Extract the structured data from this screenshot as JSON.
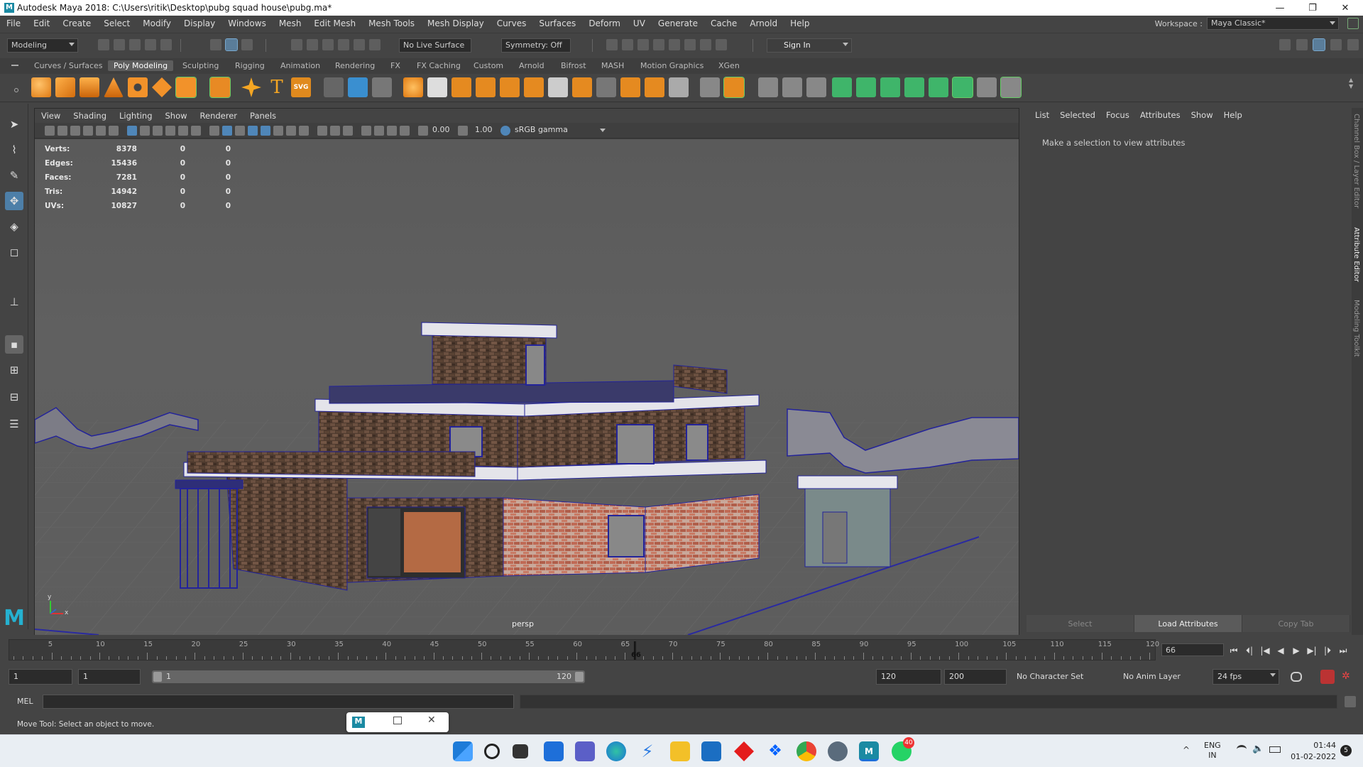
{
  "window": {
    "title": "Autodesk Maya 2018: C:\\Users\\ritik\\Desktop\\pubg squad house\\pubg.ma*",
    "app_icon": "maya-logo-icon",
    "controls": {
      "minimize": "—",
      "maximize": "❐",
      "close": "✕"
    }
  },
  "menubar": {
    "items": [
      "File",
      "Edit",
      "Create",
      "Select",
      "Modify",
      "Display",
      "Windows",
      "Mesh",
      "Edit Mesh",
      "Mesh Tools",
      "Mesh Display",
      "Curves",
      "Surfaces",
      "Deform",
      "UV",
      "Generate",
      "Cache",
      "Arnold",
      "Help"
    ],
    "workspace_label": "Workspace :",
    "workspace_value": "Maya Classic*"
  },
  "statusline": {
    "menuset": "Modeling",
    "live_surface": "No Live Surface",
    "symmetry": "Symmetry: Off",
    "sign_in": "Sign In"
  },
  "shelf": {
    "tabs": [
      "Curves / Surfaces",
      "Poly Modeling",
      "Sculpting",
      "Rigging",
      "Animation",
      "Rendering",
      "FX",
      "FX Caching",
      "Custom",
      "Arnold",
      "Bifrost",
      "MASH",
      "Motion Graphics",
      "XGen"
    ],
    "active_tab": "Poly Modeling",
    "text_tool_label": "T",
    "svg_tool_label": "SVG"
  },
  "viewport": {
    "menu": [
      "View",
      "Shading",
      "Lighting",
      "Show",
      "Renderer",
      "Panels"
    ],
    "exposure": "0.00",
    "gamma": "1.00",
    "color_space": "sRGB gamma",
    "camera_label": "persp",
    "hud": [
      {
        "label": "Verts:",
        "value": "8378",
        "sel": "0",
        "comp": "0"
      },
      {
        "label": "Edges:",
        "value": "15436",
        "sel": "0",
        "comp": "0"
      },
      {
        "label": "Faces:",
        "value": "7281",
        "sel": "0",
        "comp": "0"
      },
      {
        "label": "Tris:",
        "value": "14942",
        "sel": "0",
        "comp": "0"
      },
      {
        "label": "UVs:",
        "value": "10827",
        "sel": "0",
        "comp": "0"
      }
    ],
    "axis": {
      "x": "x",
      "y": "y"
    }
  },
  "attribute_editor": {
    "menu": [
      "List",
      "Selected",
      "Focus",
      "Attributes",
      "Show",
      "Help"
    ],
    "message": "Make a selection to view attributes",
    "buttons": {
      "select": "Select",
      "load": "Load Attributes",
      "copy": "Copy Tab"
    },
    "side_tabs": [
      "Channel Box / Layer Editor",
      "Attribute Editor",
      "Modeling Toolkit"
    ]
  },
  "timeline": {
    "tick_labels": [
      "5",
      "10",
      "15",
      "20",
      "25",
      "30",
      "35",
      "40",
      "45",
      "50",
      "55",
      "60",
      "65",
      "70",
      "75",
      "80",
      "85",
      "90",
      "95",
      "100",
      "105",
      "110",
      "115",
      "120"
    ],
    "current_frame": "66",
    "current_frame_field": "66",
    "playback_buttons": [
      "⏮",
      "⏴|",
      "|◀",
      "◀",
      "▶",
      "▶|",
      "|⏵",
      "⏭"
    ]
  },
  "range": {
    "start": "1",
    "playback_start": "1",
    "slider_start": "1",
    "slider_end": "120",
    "playback_end": "120",
    "end": "200",
    "character_set": "No Character Set",
    "anim_layer": "No Anim Layer",
    "fps": "24 fps"
  },
  "commandline": {
    "label": "MEL"
  },
  "helpline": {
    "text": "Move Tool: Select an object to move."
  },
  "taskbar": {
    "popup_label": "M",
    "lang_top": "ENG",
    "lang_bottom": "IN",
    "time": "01:44",
    "date": "01-02-2022",
    "notification_count": "5",
    "whatsapp_badge": "40"
  }
}
